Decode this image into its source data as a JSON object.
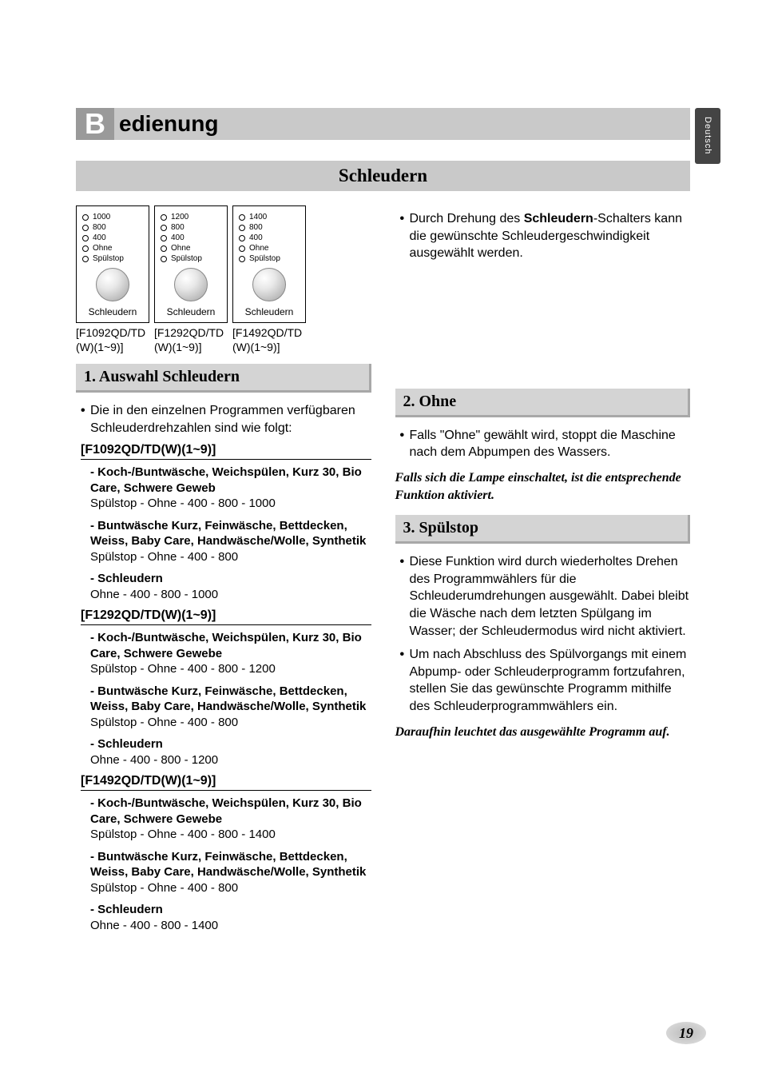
{
  "side_tab": "Deutsch",
  "title_b": "B",
  "title_text": "edienung",
  "section_banner": "Schleudern",
  "panels": [
    {
      "opts": [
        "1000",
        "800",
        "400",
        "Ohne",
        "Spülstop"
      ],
      "caption": "Schleudern",
      "sub1": "[F1092QD/TD",
      "sub2": "(W)(1~9)]"
    },
    {
      "opts": [
        "1200",
        "800",
        "400",
        "Ohne",
        "Spülstop"
      ],
      "caption": "Schleudern",
      "sub1": "[F1292QD/TD",
      "sub2": "(W)(1~9)]"
    },
    {
      "opts": [
        "1400",
        "800",
        "400",
        "Ohne",
        "Spülstop"
      ],
      "caption": "Schleudern",
      "sub1": "[F1492QD/TD",
      "sub2": "(W)(1~9)]"
    }
  ],
  "h1": "1. Auswahl Schleudern",
  "l_intro_a": "Die in den einzelnen Programmen verfügbaren",
  "l_intro_b": "Schleuderdrehzahlen sind wie folgt:",
  "models": [
    {
      "hdr": "[F1092QD/TD(W)(1~9)]",
      "progs": [
        {
          "name": "- Koch-/Buntwäsche, Weichspülen, Kurz 30, Bio Care, Schwere Geweb",
          "vals": "Spülstop - Ohne - 400 - 800 - 1000"
        },
        {
          "name": "- Buntwäsche Kurz, Feinwäsche, Bettdecken, Weiss, Baby Care, Handwäsche/Wolle, Synthetik",
          "vals": "Spülstop - Ohne - 400 - 800"
        },
        {
          "name": "- Schleudern",
          "vals": "Ohne - 400 - 800 - 1000"
        }
      ]
    },
    {
      "hdr": "[F1292QD/TD(W)(1~9)]",
      "progs": [
        {
          "name": "- Koch-/Buntwäsche, Weichspülen, Kurz 30, Bio Care, Schwere Gewebe",
          "vals": "Spülstop - Ohne - 400 - 800 - 1200"
        },
        {
          "name": "- Buntwäsche Kurz, Feinwäsche, Bettdecken, Weiss, Baby Care, Handwäsche/Wolle, Synthetik",
          "vals": "Spülstop - Ohne - 400 - 800"
        },
        {
          "name": "- Schleudern",
          "vals": "Ohne - 400 - 800 - 1200"
        }
      ]
    },
    {
      "hdr": "[F1492QD/TD(W)(1~9)]",
      "progs": [
        {
          "name": "- Koch-/Buntwäsche, Weichspülen, Kurz 30, Bio Care, Schwere Gewebe",
          "vals": "Spülstop - Ohne - 400 - 800 - 1400"
        },
        {
          "name": "- Buntwäsche Kurz, Feinwäsche, Bettdecken, Weiss, Baby Care, Handwäsche/Wolle, Synthetik",
          "vals": "Spülstop - Ohne - 400 - 800"
        },
        {
          "name": "- Schleudern",
          "vals": "Ohne - 400 - 800 - 1400"
        }
      ]
    }
  ],
  "r_intro_pre": "Durch Drehung des ",
  "r_intro_bold": "Schleudern",
  "r_intro_post": "-Schalters kann die gewünschte Schleudergeschwindigkeit ausgewählt werden.",
  "h2": "2. Ohne",
  "r2_text": "Falls \"Ohne\" gewählt wird, stoppt die Maschine nach dem Abpumpen des Wassers.",
  "r2_note": "Falls sich die Lampe einschaltet, ist die entsprechende Funktion aktiviert.",
  "h3": "3. Spülstop",
  "r3_b1": "Diese Funktion wird durch wiederholtes Drehen des Programmwählers für die Schleuderumdrehungen ausgewählt. Dabei bleibt die Wäsche nach dem letzten Spülgang im Wasser; der Schleudermodus wird nicht aktiviert.",
  "r3_b2": "Um nach Abschluss des Spülvorgangs mit einem Abpump- oder Schleuderprogramm fortzufahren, stellen Sie das gewünschte Programm mithilfe des Schleuderprogrammwählers ein.",
  "r3_note": "Daraufhin leuchtet das ausgewählte Programm auf.",
  "page_num": "19"
}
